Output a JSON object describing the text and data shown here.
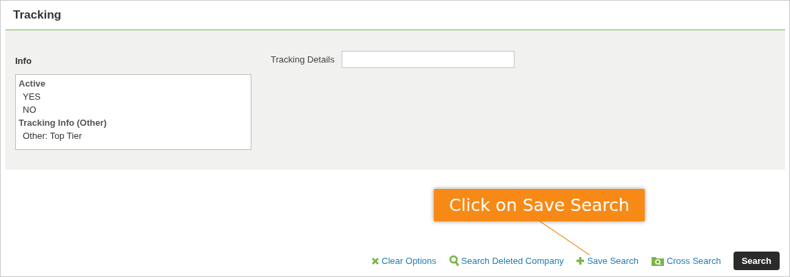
{
  "section": {
    "title": "Tracking"
  },
  "info": {
    "label": "Info",
    "list": [
      {
        "kind": "group",
        "text": "Active"
      },
      {
        "kind": "option",
        "text": "YES"
      },
      {
        "kind": "option",
        "text": "NO"
      },
      {
        "kind": "group",
        "text": "Tracking Info (Other)"
      },
      {
        "kind": "option",
        "text": "Other: Top Tier"
      }
    ]
  },
  "tracking_details": {
    "label": "Tracking Details"
  },
  "callout": {
    "text": "Click on Save Search"
  },
  "actions": [
    {
      "kind": "clear",
      "label": "Clear Options"
    },
    {
      "kind": "search-deleted",
      "label": "Search Deleted Company"
    },
    {
      "kind": "save",
      "label": "Save Search"
    },
    {
      "kind": "cross",
      "label": "Cross Search"
    }
  ],
  "search_button": {
    "label": "Search"
  }
}
